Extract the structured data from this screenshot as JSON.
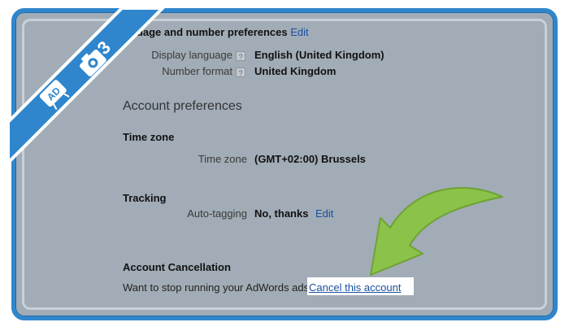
{
  "colors": {
    "frame": "#2f86cc",
    "background": "#a1acb6",
    "accent_green": "#8bc34a",
    "link": "#1a4fa0"
  },
  "badge": {
    "number": "3"
  },
  "language_section": {
    "title": "guage and number preferences",
    "edit_label": "Edit",
    "display_language_label": "Display language",
    "display_language_value": "English (United Kingdom)",
    "number_format_label": "Number format",
    "number_format_value": "United Kingdom",
    "help_glyph": "?"
  },
  "account_preferences": {
    "heading": "Account preferences",
    "time_zone_heading": "Time zone",
    "time_zone_label": "Time zone",
    "time_zone_value": "(GMT+02:00) Brussels",
    "tracking_heading": "Tracking",
    "auto_tagging_label": "Auto-tagging",
    "auto_tagging_value": "No, thanks",
    "auto_tagging_edit": "Edit"
  },
  "cancellation": {
    "heading": "Account Cancellation",
    "question": "Want to stop running your AdWords ads?",
    "link": "Cancel this account"
  },
  "icons": [
    "ad-icon",
    "camera-icon",
    "curved-arrow-icon"
  ]
}
